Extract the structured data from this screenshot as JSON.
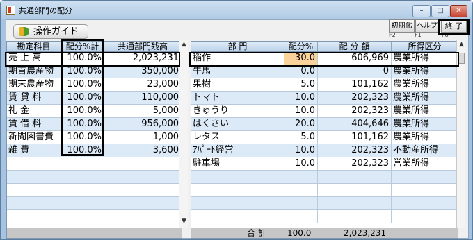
{
  "window": {
    "title": "共通部門の配分"
  },
  "titlebar_buttons": {
    "minimize": "–",
    "maximize": "□",
    "close": "✕"
  },
  "toolbar": {
    "guide_label": "操作ガイド"
  },
  "fkeys": [
    {
      "label": "初期化",
      "key": "F2"
    },
    {
      "label": "ヘルプ",
      "key": "F1"
    },
    {
      "label": "終 了",
      "key": "F8"
    }
  ],
  "left_table": {
    "headers": [
      "勘定科目",
      "配分%計",
      "共通部門残高"
    ],
    "rows": [
      {
        "account": "売 上 高",
        "pct": "100.0%",
        "balance": "2,023,231"
      },
      {
        "account": "期首農産物",
        "pct": "100.0%",
        "balance": "350,000"
      },
      {
        "account": "期末農産物",
        "pct": "100.0%",
        "balance": "23,000"
      },
      {
        "account": "賃 貸 料",
        "pct": "100.0%",
        "balance": "110,000"
      },
      {
        "account": "礼 金",
        "pct": "100.0%",
        "balance": "5,000"
      },
      {
        "account": "賃 借 料",
        "pct": "100.0%",
        "balance": "956,000"
      },
      {
        "account": "新聞図書費",
        "pct": "100.0%",
        "balance": "1,000"
      },
      {
        "account": "雑 費",
        "pct": "100.0%",
        "balance": "3,600"
      }
    ]
  },
  "right_table": {
    "headers": [
      "部 門",
      "配分%",
      "配 分 額",
      "所得区分"
    ],
    "rows": [
      {
        "dept": "稲作",
        "pct": "30.0",
        "amount": "606,969",
        "category": "農業所得"
      },
      {
        "dept": "牛馬",
        "pct": "0.0",
        "amount": "0",
        "category": "農業所得"
      },
      {
        "dept": "果樹",
        "pct": "5.0",
        "amount": "101,162",
        "category": "農業所得"
      },
      {
        "dept": "トマト",
        "pct": "10.0",
        "amount": "202,323",
        "category": "農業所得"
      },
      {
        "dept": "きゅうり",
        "pct": "10.0",
        "amount": "202,323",
        "category": "農業所得"
      },
      {
        "dept": "はくさい",
        "pct": "20.0",
        "amount": "404,646",
        "category": "農業所得"
      },
      {
        "dept": "レタス",
        "pct": "5.0",
        "amount": "101,162",
        "category": "農業所得"
      },
      {
        "dept": "ｱﾊﾟｰﾄ経営",
        "pct": "10.0",
        "amount": "202,323",
        "category": "不動産所得"
      },
      {
        "dept": "駐車場",
        "pct": "10.0",
        "amount": "202,323",
        "category": "営業所得"
      }
    ],
    "footer": {
      "label": "合 計",
      "pct": "100.0",
      "amount": "2,023,231"
    }
  },
  "colors": {
    "selected_pct": "#fcd29b",
    "stripe": "#dce9f7"
  }
}
